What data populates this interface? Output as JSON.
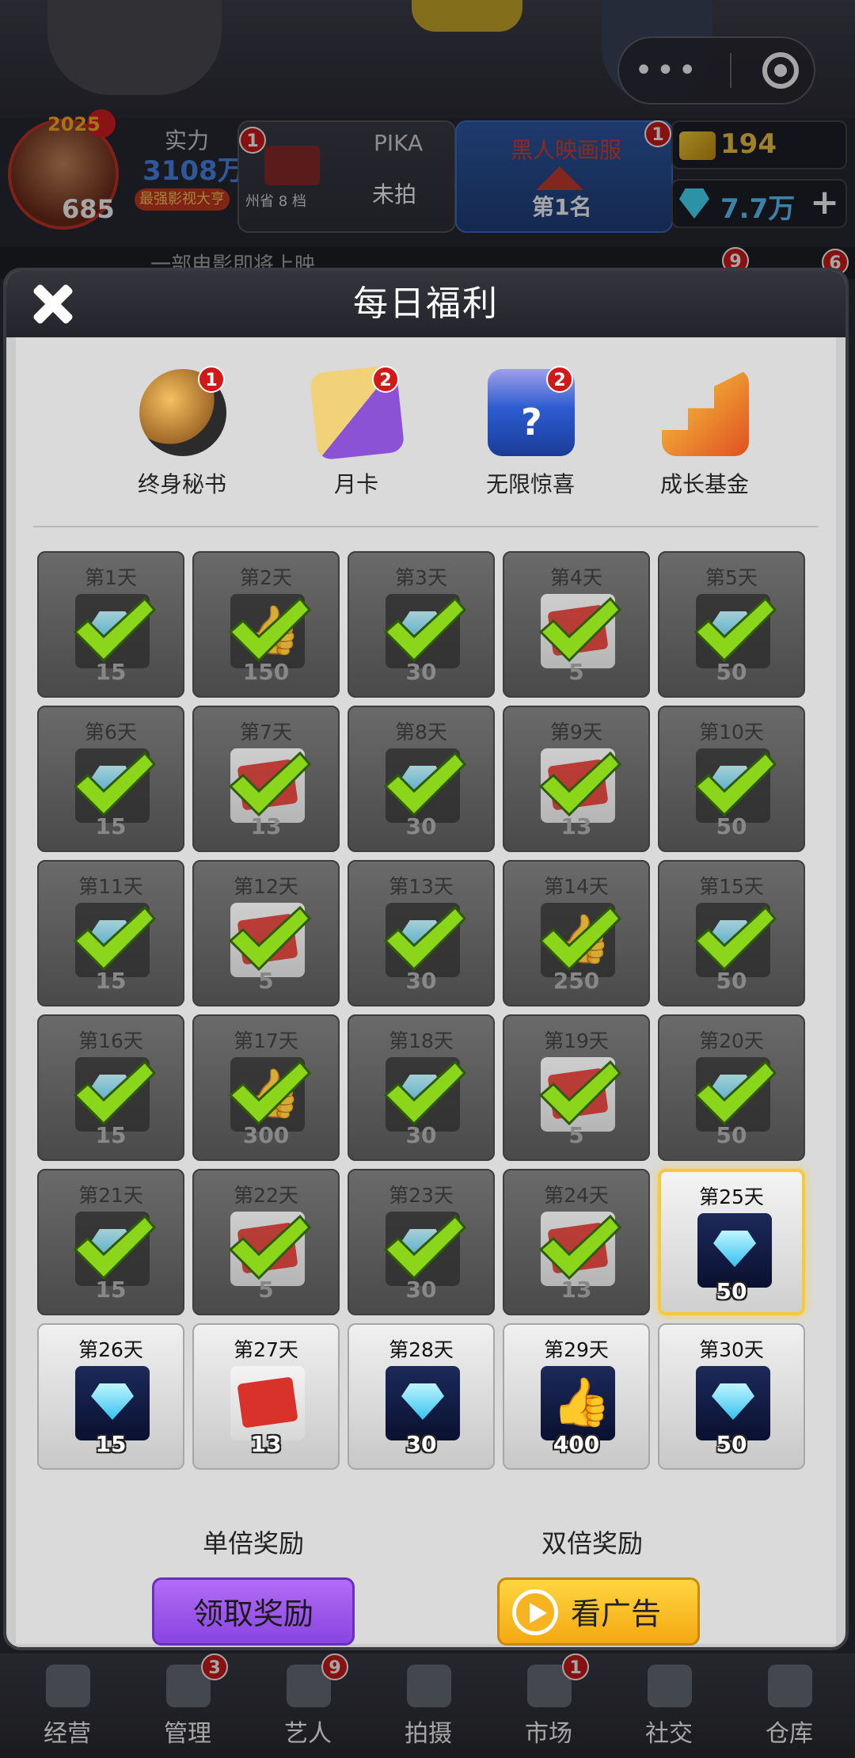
{
  "top": {
    "year": "2025",
    "player_level": "685",
    "power_label": "实力",
    "power_value": "3108万",
    "power_tag": "最强影视大亨",
    "card1": {
      "title": "PIKA",
      "status": "未拍",
      "sub": "州省 8 档",
      "badge": "1"
    },
    "card2": {
      "title": "黑人映画服",
      "rank": "第1名",
      "badge": "1"
    },
    "gold": "194",
    "diamonds": "7.7万",
    "scroll_text": "一部电影即将上映",
    "scroll_badges": [
      "9",
      "6"
    ]
  },
  "modal": {
    "title": "每日福利",
    "tabs": [
      {
        "label": "终身秘书",
        "badge": "1",
        "icon": "secretary-icon"
      },
      {
        "label": "月卡",
        "badge": "2",
        "icon": "monthly-card-icon"
      },
      {
        "label": "无限惊喜",
        "badge": "2",
        "icon": "mystery-box-icon"
      },
      {
        "label": "成长基金",
        "badge": "",
        "icon": "growth-fund-icon"
      }
    ],
    "days": [
      {
        "day": "第1天",
        "amount": "15",
        "state": "done",
        "icon": "gem-icon"
      },
      {
        "day": "第2天",
        "amount": "150",
        "state": "done",
        "icon": "like-icon"
      },
      {
        "day": "第3天",
        "amount": "30",
        "state": "done",
        "icon": "gem-icon"
      },
      {
        "day": "第4天",
        "amount": "5",
        "state": "done",
        "icon": "ticket-icon"
      },
      {
        "day": "第5天",
        "amount": "50",
        "state": "done",
        "icon": "gem-icon"
      },
      {
        "day": "第6天",
        "amount": "15",
        "state": "done",
        "icon": "gem-icon"
      },
      {
        "day": "第7天",
        "amount": "13",
        "state": "done",
        "icon": "ticket-icon"
      },
      {
        "day": "第8天",
        "amount": "30",
        "state": "done",
        "icon": "gem-icon"
      },
      {
        "day": "第9天",
        "amount": "13",
        "state": "done",
        "icon": "ticket-icon"
      },
      {
        "day": "第10天",
        "amount": "50",
        "state": "done",
        "icon": "gem-icon"
      },
      {
        "day": "第11天",
        "amount": "15",
        "state": "done",
        "icon": "gem-icon"
      },
      {
        "day": "第12天",
        "amount": "5",
        "state": "done",
        "icon": "ticket-icon"
      },
      {
        "day": "第13天",
        "amount": "30",
        "state": "done",
        "icon": "gem-icon"
      },
      {
        "day": "第14天",
        "amount": "250",
        "state": "done",
        "icon": "like-icon"
      },
      {
        "day": "第15天",
        "amount": "50",
        "state": "done",
        "icon": "gem-icon"
      },
      {
        "day": "第16天",
        "amount": "15",
        "state": "done",
        "icon": "gem-icon"
      },
      {
        "day": "第17天",
        "amount": "300",
        "state": "done",
        "icon": "like-icon"
      },
      {
        "day": "第18天",
        "amount": "30",
        "state": "done",
        "icon": "gem-icon"
      },
      {
        "day": "第19天",
        "amount": "5",
        "state": "done",
        "icon": "ticket-icon"
      },
      {
        "day": "第20天",
        "amount": "50",
        "state": "done",
        "icon": "gem-icon"
      },
      {
        "day": "第21天",
        "amount": "15",
        "state": "done",
        "icon": "gem-icon"
      },
      {
        "day": "第22天",
        "amount": "5",
        "state": "done",
        "icon": "ticket-icon"
      },
      {
        "day": "第23天",
        "amount": "30",
        "state": "done",
        "icon": "gem-icon"
      },
      {
        "day": "第24天",
        "amount": "13",
        "state": "done",
        "icon": "ticket-icon"
      },
      {
        "day": "第25天",
        "amount": "50",
        "state": "today",
        "icon": "gem-icon"
      },
      {
        "day": "第26天",
        "amount": "15",
        "state": "avail",
        "icon": "gem-icon"
      },
      {
        "day": "第27天",
        "amount": "13",
        "state": "avail",
        "icon": "ticket-icon"
      },
      {
        "day": "第28天",
        "amount": "30",
        "state": "avail",
        "icon": "gem-icon"
      },
      {
        "day": "第29天",
        "amount": "400",
        "state": "avail",
        "icon": "like-icon"
      },
      {
        "day": "第30天",
        "amount": "50",
        "state": "avail",
        "icon": "gem-icon"
      }
    ],
    "single_label": "单倍奖励",
    "single_button": "领取奖励",
    "double_label": "双倍奖励",
    "double_button": "看广告"
  },
  "nav": [
    {
      "label": "经营",
      "badge": "",
      "icon": "business-icon"
    },
    {
      "label": "管理",
      "badge": "3",
      "icon": "manage-icon"
    },
    {
      "label": "艺人",
      "badge": "9",
      "icon": "artist-icon"
    },
    {
      "label": "拍摄",
      "badge": "",
      "icon": "camera-icon"
    },
    {
      "label": "市场",
      "badge": "1",
      "icon": "market-icon"
    },
    {
      "label": "社交",
      "badge": "",
      "icon": "social-icon"
    },
    {
      "label": "仓库",
      "badge": "",
      "icon": "warehouse-icon"
    }
  ]
}
